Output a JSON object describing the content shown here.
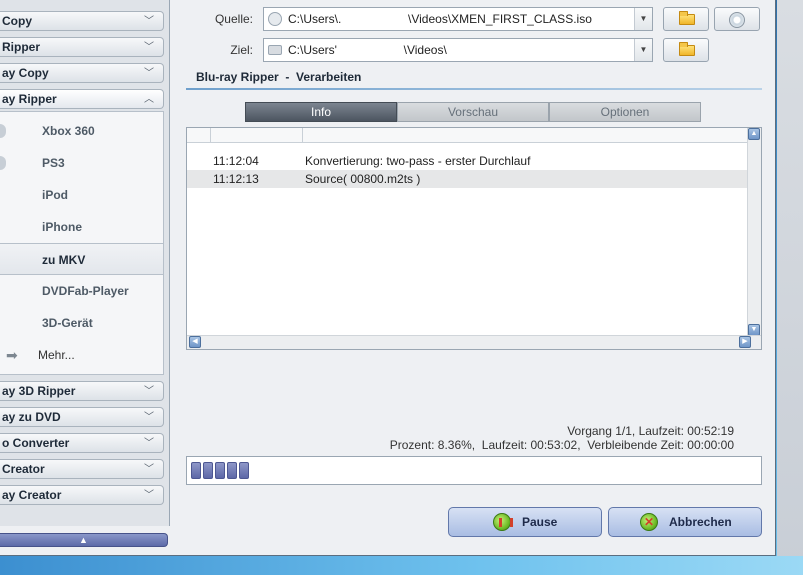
{
  "sidebar": {
    "top_categories": [
      {
        "label": "Copy"
      },
      {
        "label": "Ripper"
      },
      {
        "label": "ay Copy"
      },
      {
        "label": "ay Ripper"
      }
    ],
    "sub_items": [
      {
        "label": "Xbox 360"
      },
      {
        "label": "PS3"
      },
      {
        "label": "iPod"
      },
      {
        "label": "iPhone"
      },
      {
        "label": "zu MKV"
      },
      {
        "label": "DVDFab-Player"
      },
      {
        "label": "3D-Gerät"
      },
      {
        "label": "Mehr..."
      }
    ],
    "selected_item": "zu MKV",
    "bottom_categories": [
      {
        "label": "ay 3D Ripper"
      },
      {
        "label": "ay zu DVD"
      },
      {
        "label": "o Converter"
      },
      {
        "label": " Creator"
      },
      {
        "label": "ay Creator"
      }
    ]
  },
  "source": {
    "label": "Quelle:",
    "value": "C:\\Users\\.                    \\Videos\\XMEN_FIRST_CLASS.iso"
  },
  "target": {
    "label": "Ziel:",
    "value": "C:\\Users'                    \\Videos\\"
  },
  "section_title": "Blu-ray Ripper  -  Verarbeiten",
  "tabs": [
    {
      "label": "Info",
      "active": true
    },
    {
      "label": "Vorschau",
      "active": false
    },
    {
      "label": "Optionen",
      "active": false
    }
  ],
  "log": [
    {
      "time": "11:12:04",
      "message": "Konvertierung: two-pass - erster Durchlauf"
    },
    {
      "time": "11:12:13",
      "message": "Source( 00800.m2ts )"
    }
  ],
  "status": {
    "line1": "Vorgang 1/1, Laufzeit: 00:52:19",
    "line2": "Prozent: 8.36%,  Laufzeit: 00:53:02,  Verbleibende Zeit: 00:00:00"
  },
  "progress_percent": 8.36,
  "buttons": {
    "pause": "Pause",
    "cancel": "Abbrechen"
  },
  "colors": {
    "window_bg": "#eef0f3",
    "tab_active": "#4c5560",
    "progress_segment": "#5d67a6",
    "action_button": "#a9bde3"
  },
  "icons": {
    "source_browse": "folder-icon",
    "source_disc": "disc-icon",
    "target_browse": "folder-icon",
    "more": "arrow-right-icon",
    "pause": "pause-icon",
    "cancel": "cancel-icon"
  }
}
